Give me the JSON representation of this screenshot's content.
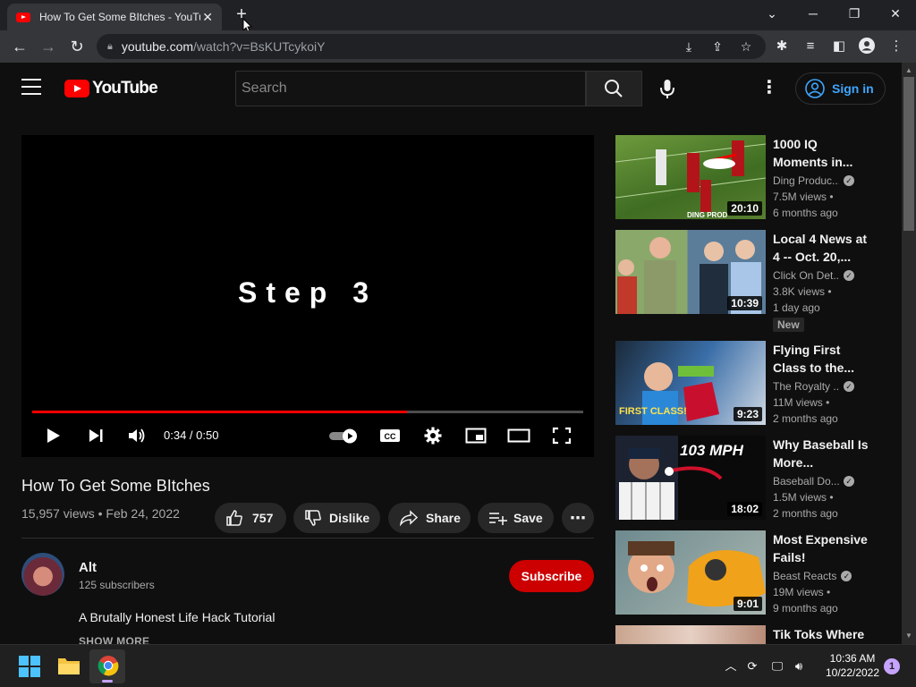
{
  "browser": {
    "tab_title": "How To Get Some BItches - YouTube",
    "url_host": "youtube.com",
    "url_rest": "/watch?v=BsKUTcykoiY"
  },
  "youtube": {
    "logo_text": "YouTube",
    "search_placeholder": "Search",
    "signin_label": "Sign in"
  },
  "player": {
    "overlay_text": "Step 3",
    "time_display": "0:34 / 0:50",
    "progress": 0.68
  },
  "video": {
    "title": "How To Get Some BItches",
    "meta": "15,957 views • Feb 24, 2022",
    "likes": "757",
    "dislike_label": "Dislike",
    "share_label": "Share",
    "save_label": "Save",
    "channel_name": "Alt",
    "subscribers": "125 subscribers",
    "subscribe_label": "Subscribe",
    "description": "A Brutally Honest Life Hack Tutorial",
    "show_more": "SHOW MORE"
  },
  "recommendations": [
    {
      "title": "1000 IQ Moments in...",
      "channel": "Ding Produc...",
      "views": "7.5M views •",
      "age": "6 months ago",
      "duration": "20:10",
      "badge": ""
    },
    {
      "title": "Local 4 News at 4 -- Oct. 20,...",
      "channel": "Click On Det...",
      "views": "3.8K views •",
      "age": "1 day ago",
      "duration": "10:39",
      "badge": "New"
    },
    {
      "title": "Flying First Class to the...",
      "channel": "The Royalty ...",
      "views": "11M views •",
      "age": "2 months ago",
      "duration": "9:23",
      "badge": ""
    },
    {
      "title": "Why Baseball Is More...",
      "channel": "Baseball Do...",
      "views": "1.5M views •",
      "age": "2 months ago",
      "duration": "18:02",
      "badge": ""
    },
    {
      "title": "Most Expensive Fails!",
      "channel": "Beast Reacts",
      "views": "19M views •",
      "age": "9 months ago",
      "duration": "9:01",
      "badge": ""
    },
    {
      "title": "Tik Toks Where",
      "channel": "",
      "views": "",
      "age": "",
      "duration": "",
      "badge": ""
    }
  ],
  "thumb_text": {
    "rec0_caption": "DING PROD",
    "rec2_caption": "FIRST CLASS!",
    "rec3_caption": "103 MPH"
  },
  "taskbar": {
    "time": "10:36 AM",
    "date": "10/22/2022",
    "notifications": "1"
  },
  "colors": {
    "accent": "#ff0000",
    "link": "#3ea6ff",
    "subscribe": "#cc0000"
  }
}
